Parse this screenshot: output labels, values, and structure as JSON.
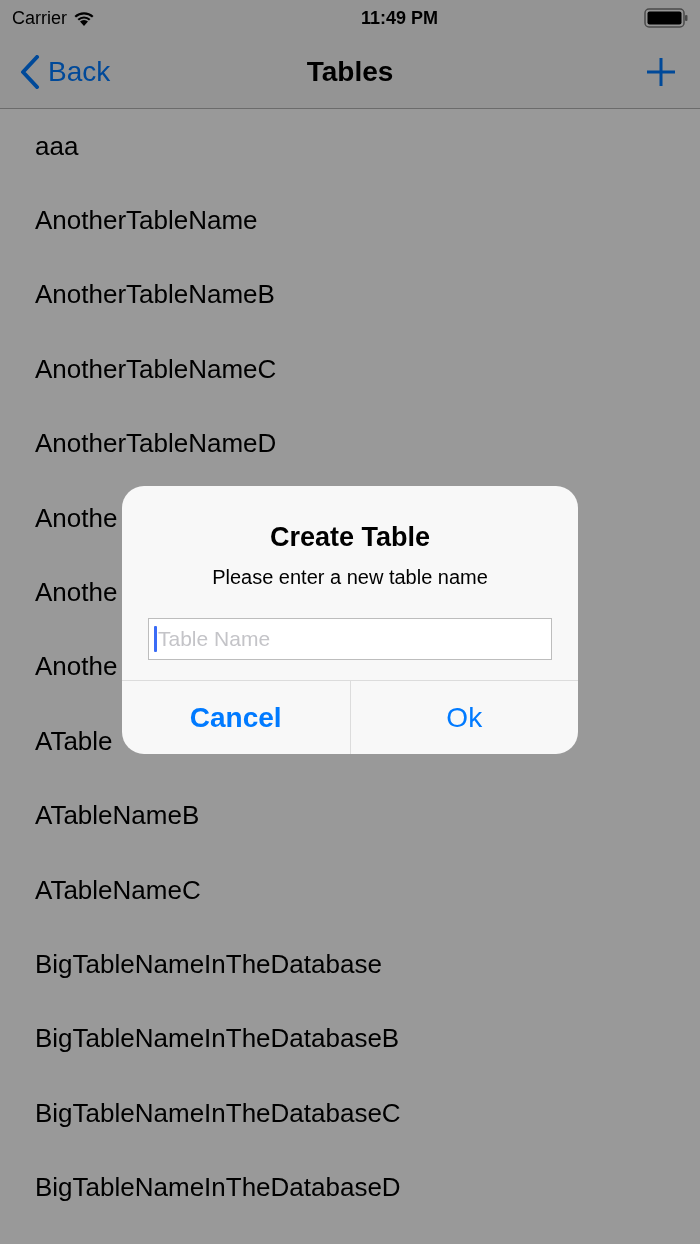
{
  "status_bar": {
    "carrier": "Carrier",
    "time": "11:49 PM"
  },
  "nav_bar": {
    "back": "Back",
    "title": "Tables"
  },
  "rows": [
    {
      "label": "aaa"
    },
    {
      "label": "AnotherTableName"
    },
    {
      "label": "AnotherTableNameB"
    },
    {
      "label": "AnotherTableNameC"
    },
    {
      "label": "AnotherTableNameD"
    },
    {
      "label": "Anothe"
    },
    {
      "label": "Anothe"
    },
    {
      "label": "Anothe"
    },
    {
      "label": "ATable"
    },
    {
      "label": "ATableNameB"
    },
    {
      "label": "ATableNameC"
    },
    {
      "label": "BigTableNameInTheDatabase"
    },
    {
      "label": "BigTableNameInTheDatabaseB"
    },
    {
      "label": "BigTableNameInTheDatabaseC"
    },
    {
      "label": "BigTableNameInTheDatabaseD"
    }
  ],
  "alert": {
    "title": "Create Table",
    "message": "Please enter a new table name",
    "field": {
      "placeholder": "Table Name",
      "focused": true
    },
    "buttons": [
      {
        "label": "Cancel",
        "kind": "preferred"
      },
      {
        "label": "Ok",
        "kind": "default"
      }
    ]
  }
}
